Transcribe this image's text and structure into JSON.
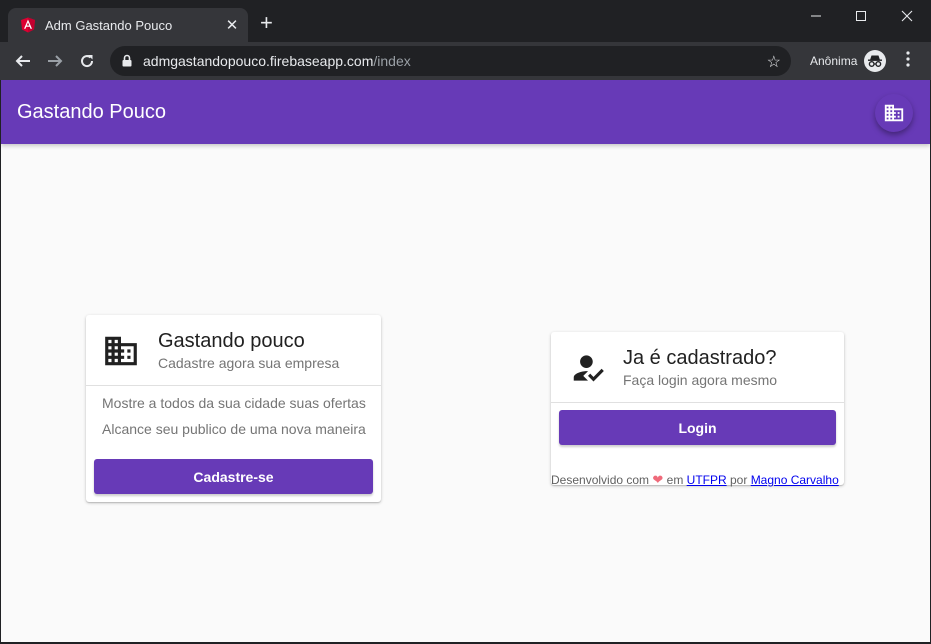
{
  "browser": {
    "tab_title": "Adm Gastando Pouco",
    "new_tab": "+",
    "url_host": "admgastandopouco.firebaseapp.com",
    "url_path": "/index",
    "profile_label": "Anônima",
    "icons": [
      "angular-favicon",
      "close-icon",
      "minimize-icon",
      "maximize-icon",
      "back-icon",
      "forward-icon",
      "reload-icon",
      "lock-icon",
      "star-icon",
      "incognito-icon",
      "menu-icon"
    ]
  },
  "appbar": {
    "title": "Gastando Pouco",
    "fab_icon": "business-icon"
  },
  "register_card": {
    "title": "Gastando pouco",
    "subtitle": "Cadastre agora sua empresa",
    "lines": [
      "Mostre a todos da sua cidade suas ofertas",
      "Alcance seu publico de uma nova maneira"
    ],
    "button": "Cadastre-se",
    "icon": "business-icon"
  },
  "login_card": {
    "title": "Ja é cadastrado?",
    "subtitle": "Faça login agora mesmo",
    "button": "Login",
    "icon": "how-to-reg-icon"
  },
  "footer": {
    "prefix": "Desenvolvido com",
    "heart": "❤",
    "in": "em",
    "org": "UTFPR",
    "by": "por",
    "author": "Magno Carvalho"
  },
  "colors": {
    "primary": "#673ab7",
    "background": "#fafafa",
    "chrome_dark": "#202124",
    "chrome_toolbar": "#35363a"
  }
}
